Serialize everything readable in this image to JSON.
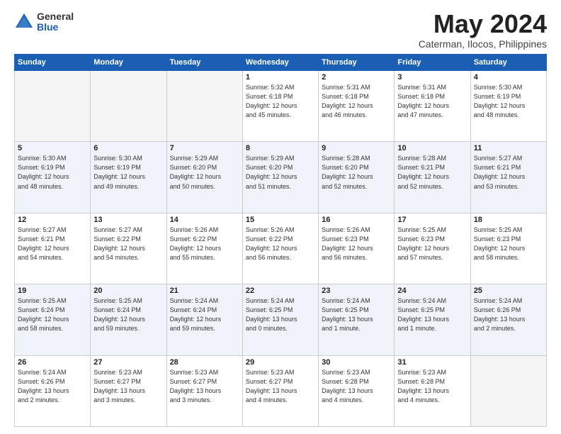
{
  "logo": {
    "general": "General",
    "blue": "Blue"
  },
  "title": {
    "month": "May 2024",
    "location": "Caterman, Ilocos, Philippines"
  },
  "weekdays": [
    "Sunday",
    "Monday",
    "Tuesday",
    "Wednesday",
    "Thursday",
    "Friday",
    "Saturday"
  ],
  "weeks": [
    [
      {
        "day": "",
        "info": ""
      },
      {
        "day": "",
        "info": ""
      },
      {
        "day": "",
        "info": ""
      },
      {
        "day": "1",
        "info": "Sunrise: 5:32 AM\nSunset: 6:18 PM\nDaylight: 12 hours\nand 45 minutes."
      },
      {
        "day": "2",
        "info": "Sunrise: 5:31 AM\nSunset: 6:18 PM\nDaylight: 12 hours\nand 46 minutes."
      },
      {
        "day": "3",
        "info": "Sunrise: 5:31 AM\nSunset: 6:18 PM\nDaylight: 12 hours\nand 47 minutes."
      },
      {
        "day": "4",
        "info": "Sunrise: 5:30 AM\nSunset: 6:19 PM\nDaylight: 12 hours\nand 48 minutes."
      }
    ],
    [
      {
        "day": "5",
        "info": "Sunrise: 5:30 AM\nSunset: 6:19 PM\nDaylight: 12 hours\nand 48 minutes."
      },
      {
        "day": "6",
        "info": "Sunrise: 5:30 AM\nSunset: 6:19 PM\nDaylight: 12 hours\nand 49 minutes."
      },
      {
        "day": "7",
        "info": "Sunrise: 5:29 AM\nSunset: 6:20 PM\nDaylight: 12 hours\nand 50 minutes."
      },
      {
        "day": "8",
        "info": "Sunrise: 5:29 AM\nSunset: 6:20 PM\nDaylight: 12 hours\nand 51 minutes."
      },
      {
        "day": "9",
        "info": "Sunrise: 5:28 AM\nSunset: 6:20 PM\nDaylight: 12 hours\nand 52 minutes."
      },
      {
        "day": "10",
        "info": "Sunrise: 5:28 AM\nSunset: 6:21 PM\nDaylight: 12 hours\nand 52 minutes."
      },
      {
        "day": "11",
        "info": "Sunrise: 5:27 AM\nSunset: 6:21 PM\nDaylight: 12 hours\nand 53 minutes."
      }
    ],
    [
      {
        "day": "12",
        "info": "Sunrise: 5:27 AM\nSunset: 6:21 PM\nDaylight: 12 hours\nand 54 minutes."
      },
      {
        "day": "13",
        "info": "Sunrise: 5:27 AM\nSunset: 6:22 PM\nDaylight: 12 hours\nand 54 minutes."
      },
      {
        "day": "14",
        "info": "Sunrise: 5:26 AM\nSunset: 6:22 PM\nDaylight: 12 hours\nand 55 minutes."
      },
      {
        "day": "15",
        "info": "Sunrise: 5:26 AM\nSunset: 6:22 PM\nDaylight: 12 hours\nand 56 minutes."
      },
      {
        "day": "16",
        "info": "Sunrise: 5:26 AM\nSunset: 6:23 PM\nDaylight: 12 hours\nand 56 minutes."
      },
      {
        "day": "17",
        "info": "Sunrise: 5:25 AM\nSunset: 6:23 PM\nDaylight: 12 hours\nand 57 minutes."
      },
      {
        "day": "18",
        "info": "Sunrise: 5:25 AM\nSunset: 6:23 PM\nDaylight: 12 hours\nand 58 minutes."
      }
    ],
    [
      {
        "day": "19",
        "info": "Sunrise: 5:25 AM\nSunset: 6:24 PM\nDaylight: 12 hours\nand 58 minutes."
      },
      {
        "day": "20",
        "info": "Sunrise: 5:25 AM\nSunset: 6:24 PM\nDaylight: 12 hours\nand 59 minutes."
      },
      {
        "day": "21",
        "info": "Sunrise: 5:24 AM\nSunset: 6:24 PM\nDaylight: 12 hours\nand 59 minutes."
      },
      {
        "day": "22",
        "info": "Sunrise: 5:24 AM\nSunset: 6:25 PM\nDaylight: 13 hours\nand 0 minutes."
      },
      {
        "day": "23",
        "info": "Sunrise: 5:24 AM\nSunset: 6:25 PM\nDaylight: 13 hours\nand 1 minute."
      },
      {
        "day": "24",
        "info": "Sunrise: 5:24 AM\nSunset: 6:25 PM\nDaylight: 13 hours\nand 1 minute."
      },
      {
        "day": "25",
        "info": "Sunrise: 5:24 AM\nSunset: 6:26 PM\nDaylight: 13 hours\nand 2 minutes."
      }
    ],
    [
      {
        "day": "26",
        "info": "Sunrise: 5:24 AM\nSunset: 6:26 PM\nDaylight: 13 hours\nand 2 minutes."
      },
      {
        "day": "27",
        "info": "Sunrise: 5:23 AM\nSunset: 6:27 PM\nDaylight: 13 hours\nand 3 minutes."
      },
      {
        "day": "28",
        "info": "Sunrise: 5:23 AM\nSunset: 6:27 PM\nDaylight: 13 hours\nand 3 minutes."
      },
      {
        "day": "29",
        "info": "Sunrise: 5:23 AM\nSunset: 6:27 PM\nDaylight: 13 hours\nand 4 minutes."
      },
      {
        "day": "30",
        "info": "Sunrise: 5:23 AM\nSunset: 6:28 PM\nDaylight: 13 hours\nand 4 minutes."
      },
      {
        "day": "31",
        "info": "Sunrise: 5:23 AM\nSunset: 6:28 PM\nDaylight: 13 hours\nand 4 minutes."
      },
      {
        "day": "",
        "info": ""
      }
    ]
  ]
}
